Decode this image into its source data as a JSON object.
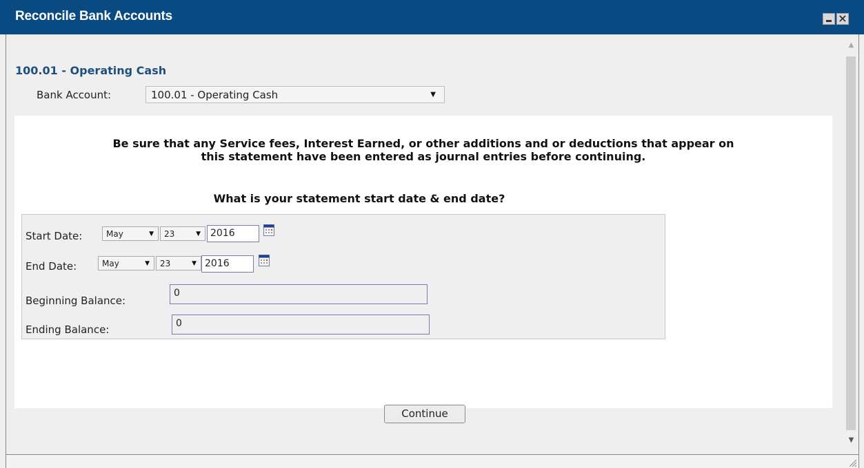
{
  "window": {
    "title": "Reconcile Bank Accounts"
  },
  "account": {
    "heading": "100.01 - Operating Cash"
  },
  "bank_account": {
    "label": "Bank Account:",
    "selected": "100.01 - Operating Cash"
  },
  "instructions": {
    "warning_line1": "Be sure that any Service fees, Interest Earned, or other additions and or deductions that appear on",
    "warning_line2": "this statement have been entered as journal entries before continuing.",
    "date_question": "What is your statement start date & end date?"
  },
  "start_date": {
    "label": "Start Date:",
    "month": "May",
    "day": "23",
    "year": "2016"
  },
  "end_date": {
    "label": "End Date:",
    "month": "May",
    "day": "23",
    "year": "2016"
  },
  "beginning_balance": {
    "label": "Beginning Balance:",
    "value": "0"
  },
  "ending_balance": {
    "label": "Ending Balance:",
    "value": "0"
  },
  "actions": {
    "continue_label": "Continue"
  },
  "colors": {
    "titlebar": "#0a4a82",
    "heading": "#1f4f7f",
    "background": "#efefef",
    "panel": "#ffffff"
  },
  "icons": [
    "minimize-icon",
    "close-icon",
    "chevron-down-icon",
    "calendar-icon",
    "resize-grip-icon"
  ]
}
